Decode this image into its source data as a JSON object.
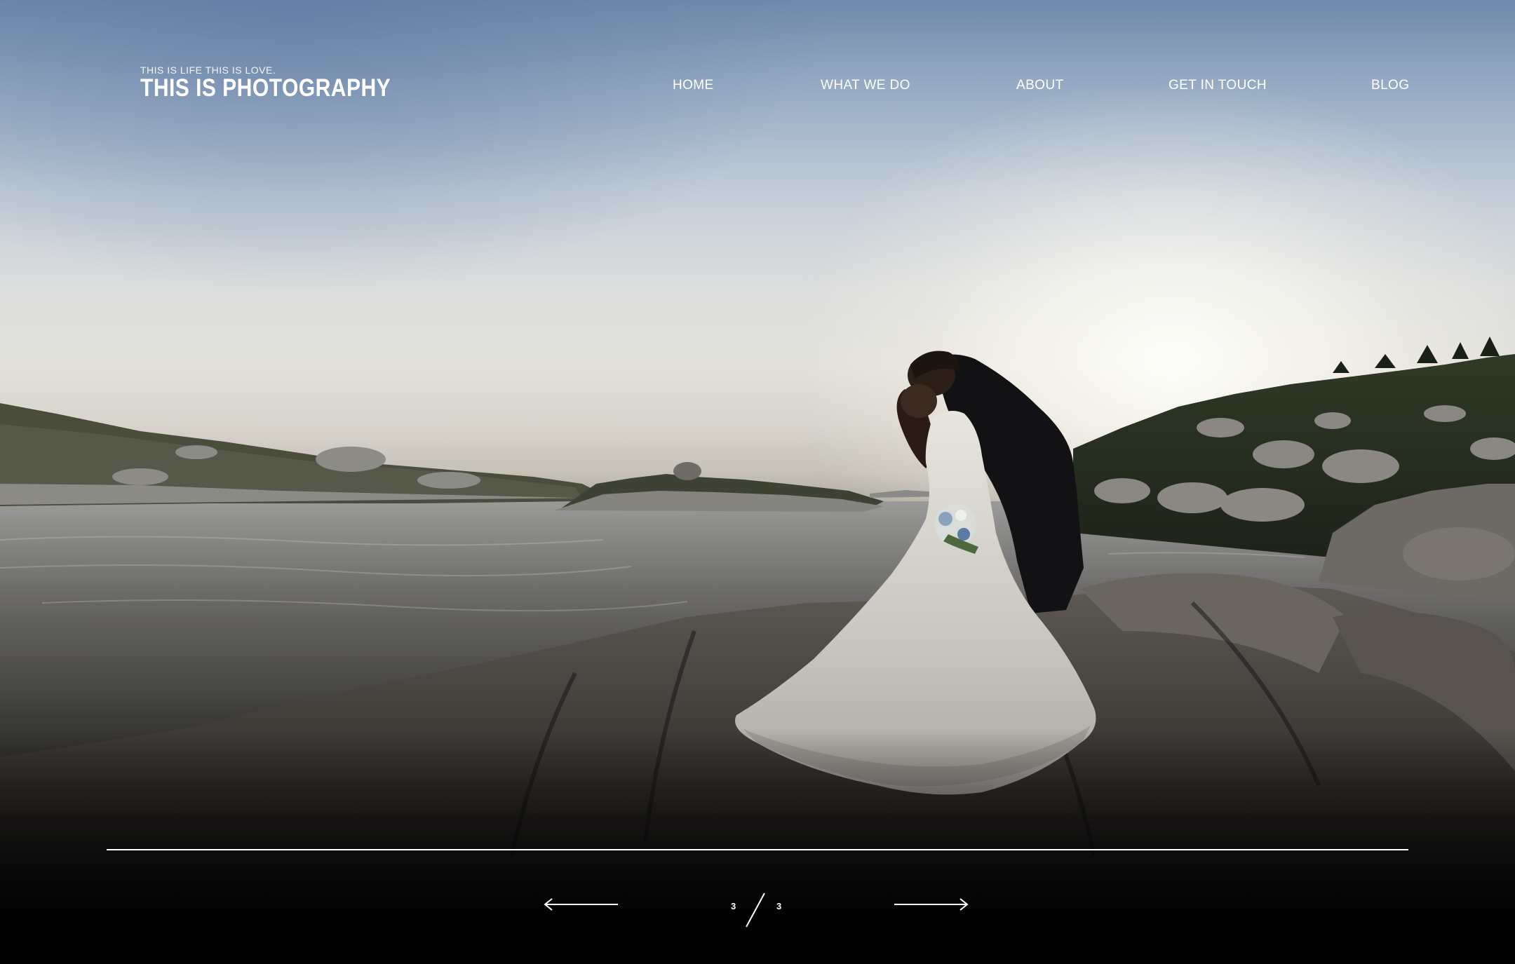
{
  "brand": {
    "tagline": "THIS IS LIFE THIS IS LOVE.",
    "name": "THIS IS PHOTOGRAPHY"
  },
  "nav": {
    "items": [
      {
        "label": "HOME"
      },
      {
        "label": "WHAT WE DO"
      },
      {
        "label": "ABOUT"
      },
      {
        "label": "GET IN TOUCH"
      },
      {
        "label": "BLOG"
      }
    ]
  },
  "slider": {
    "current": "3",
    "total": "3",
    "prev_icon": "arrow-left-icon",
    "next_icon": "arrow-right-icon"
  },
  "hero": {
    "image": "wedding-couple-kiss-on-rocks-by-water-at-sunset"
  },
  "colors": {
    "text": "#ffffff",
    "overlay": "#000000"
  }
}
